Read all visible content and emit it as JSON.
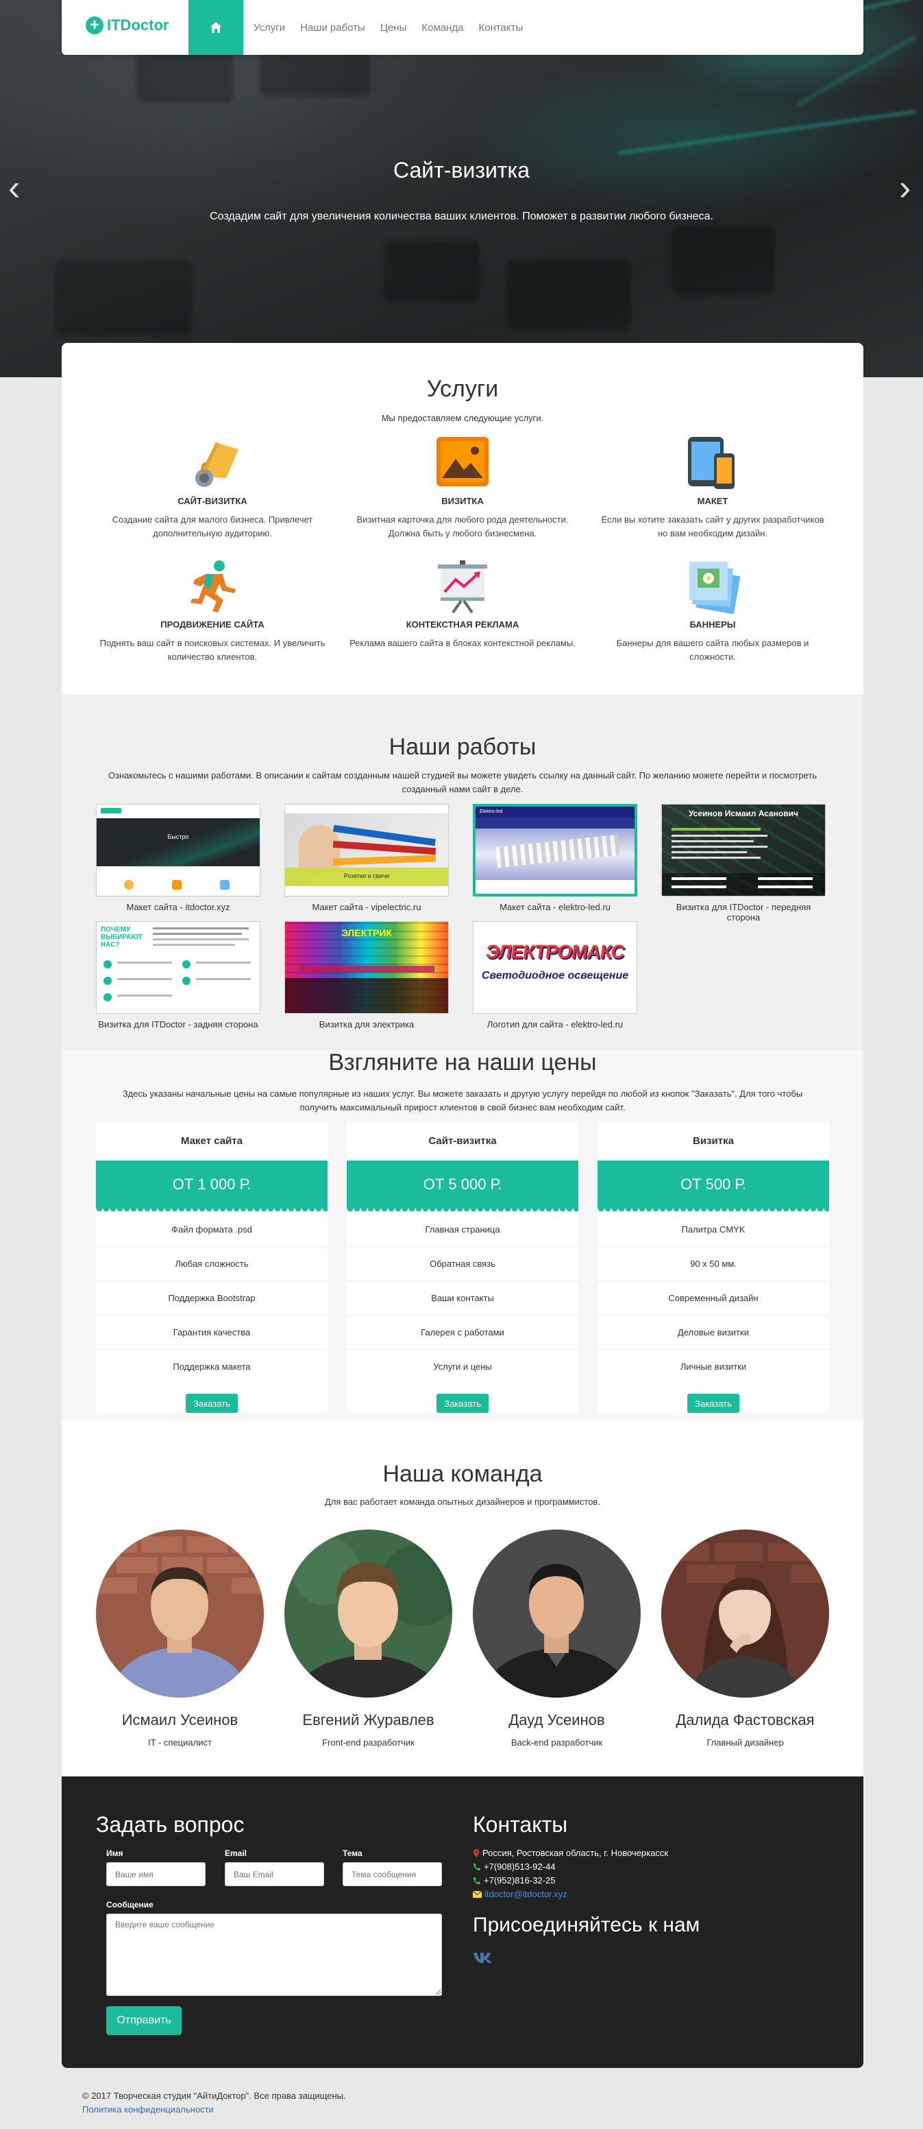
{
  "nav": {
    "logo_text": "ITDoctor",
    "links": [
      "Услуги",
      "Наши работы",
      "Цены",
      "Команда",
      "Контакты"
    ]
  },
  "hero": {
    "title": "Сайт-визитка",
    "subtitle": "Создадим сайт для увеличения количества ваших клиентов. Поможет в развитии любого бизнеса."
  },
  "services": {
    "title": "Услуги",
    "subtitle": "Мы предоставляем следующие услуги.",
    "items": [
      {
        "title": "Сайт-визитка",
        "desc": "Создание сайта для малого бизнеса. Привлечет дополнительную аудиторию.",
        "icon": "hand-pointer-icon"
      },
      {
        "title": "Визитка",
        "desc": "Визитная карточка для любого рода деятельности. Должна быть у любого бизнесмена.",
        "icon": "image-icon"
      },
      {
        "title": "Макет",
        "desc": "Если вы хотите заказать сайт у других разработчиков но вам необходим дизайн.",
        "icon": "devices-icon"
      },
      {
        "title": "Продвижение сайта",
        "desc": "Поднять ваш сайт в поисковых системах. И увеличить количество клиентов.",
        "icon": "runner-icon"
      },
      {
        "title": "Контекстная реклама",
        "desc": "Реклама вашего сайта в блоках контекстной рекламы.",
        "icon": "presentation-icon"
      },
      {
        "title": "Баннеры",
        "desc": "Баннеры для вашего сайта любых размеров и сложности.",
        "icon": "banners-icon"
      }
    ]
  },
  "works": {
    "title": "Наши работы",
    "intro": "Ознакомьтесь с нашими работами. В описании к сайтам созданным нашей студией вы можете увидеть ссылку на данный сайт. По желанию можете перейти и посмотреть созданный нами сайт в деле.",
    "items": [
      {
        "caption": "Макет сайта - itdoctor.xyz",
        "thumb_text": "Быстро"
      },
      {
        "caption": "Макет сайта - vipelectric.ru",
        "thumb_text": "Розетки и свичи"
      },
      {
        "caption": "Макет сайта - elektro-led.ru",
        "thumb_text": "Elektro-led"
      },
      {
        "caption": "Визитка для ITDoctor - передняя сторона",
        "thumb_text": "Усеинов Исмаил Асанович"
      },
      {
        "caption": "Визитка для ITDoctor - задняя сторона",
        "thumb_text": "ПОЧЕМУ ВЫБИРАЮТ НАС?"
      },
      {
        "caption": "Визитка для электрика",
        "thumb_text": "ЭЛЕКТРИК"
      },
      {
        "caption": "Логотип для сайта - elektro-led.ru",
        "thumb_text": "ЭЛЕКТРОМАКС",
        "thumb_sub": "Светодиодное освещение"
      }
    ]
  },
  "prices": {
    "title": "Взгляните на наши цены",
    "intro": "Здесь указаны начальные цены на самые популярные из наших услуг. Вы можете заказать и другую услугу перейдя по любой из кнопок \"Заказать\". Для того чтобы получить максимальный прирост клиентов в свой бизнес вам необходим сайт.",
    "order_label": "Заказать",
    "plans": [
      {
        "name": "Макет сайта",
        "price": "ОТ 1 000 Р.",
        "features": [
          "Файл формата .psd",
          "Любая сложность",
          "Поддержка Bootstrap",
          "Гарантия качества",
          "Поддержка макета"
        ]
      },
      {
        "name": "Сайт-визитка",
        "price": "ОТ 5 000 Р.",
        "features": [
          "Главная страница",
          "Обратная связь",
          "Ваши контакты",
          "Галерея с работами",
          "Услуги и цены"
        ]
      },
      {
        "name": "Визитка",
        "price": "ОТ 500 Р.",
        "features": [
          "Палитра CMYK",
          "90 х 50 мм.",
          "Современный дизайн",
          "Деловые визитки",
          "Личные визитки"
        ]
      }
    ]
  },
  "team": {
    "title": "Наша команда",
    "subtitle": "Для вас работает команда опытных дизайнеров и программистов.",
    "members": [
      {
        "name": "Исмаил Усеинов",
        "role": "IT - специалист"
      },
      {
        "name": "Евгений Журавлев",
        "role": "Front-end разработчик"
      },
      {
        "name": "Дауд Усеинов",
        "role": "Back-end разработчик"
      },
      {
        "name": "Далида Фастовская",
        "role": "Главный дизайнер"
      }
    ]
  },
  "footer": {
    "ask_title": "Задать вопрос",
    "name_label": "Имя",
    "name_placeholder": "Ваше имя",
    "email_label": "Email",
    "email_placeholder": "Ваш Email",
    "topic_label": "Тема",
    "topic_placeholder": "Тема сообщения",
    "message_label": "Сообщение",
    "message_placeholder": "Введите ваше сообщение",
    "send_label": "Отправить",
    "contacts_title": "Контакты",
    "address": "Россия, Ростовская область, г. Новочеркасск",
    "phone1": "+7(908)513-92-44",
    "phone2": "+7(952)816-32-25",
    "email": "itdoctor@itdoctor.xyz",
    "join_title": "Присоединяйтесь к нам",
    "social_icon": "vk-icon"
  },
  "bottom": {
    "copyright": "© 2017 Творческая студия \"АйтиДоктор\". Все права защищены.",
    "policy": "Политика конфиденциальности"
  },
  "colors": {
    "accent": "#1abc9c",
    "footer_bg": "#212121",
    "link": "#2a6ebb",
    "vk": "#4a76a8"
  }
}
